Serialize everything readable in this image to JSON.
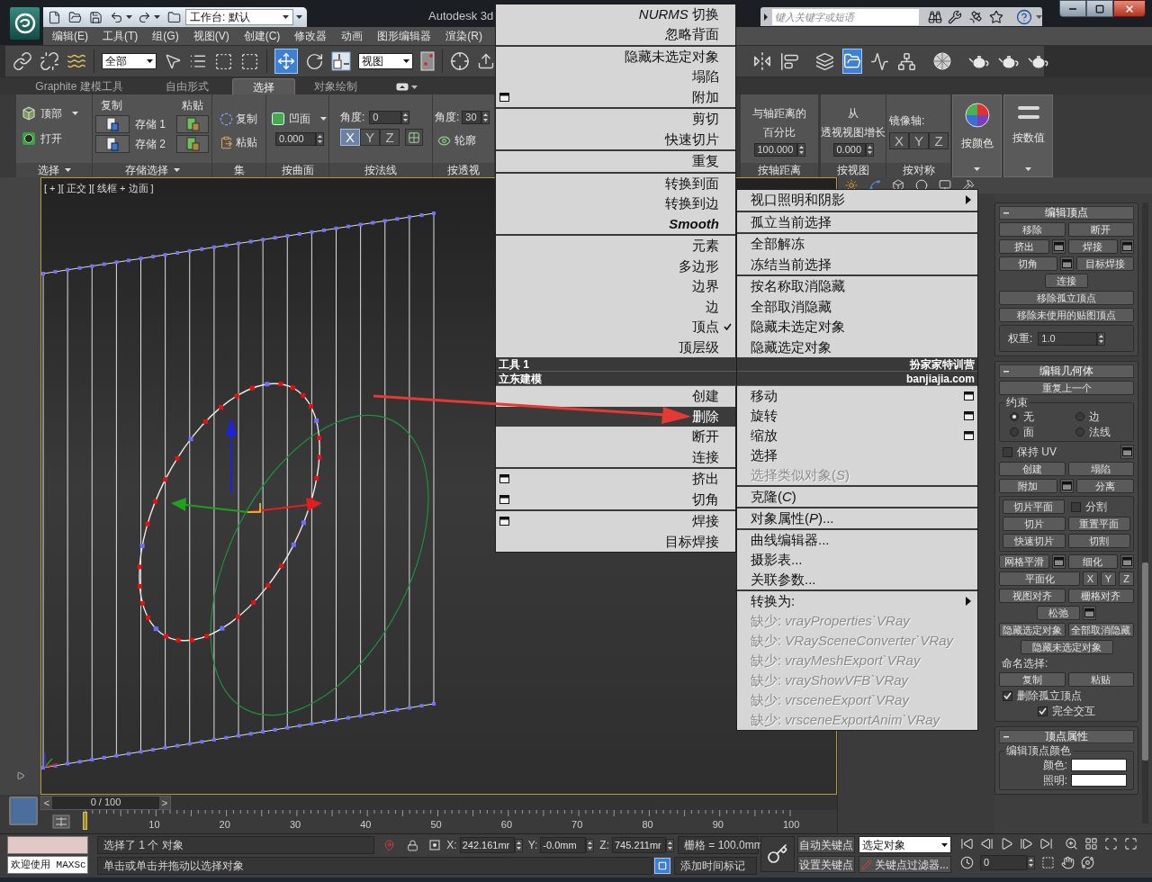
{
  "title_bar": {
    "workspace": "工作台: 默认",
    "app_title": "Autodesk 3d",
    "search": {
      "placeholder": "键入关键字或短语"
    }
  },
  "menu_bar": [
    "编辑(E)",
    "工具(T)",
    "组(G)",
    "视图(V)",
    "创建(C)",
    "修改器",
    "动画",
    "图形编辑器",
    "渲染(R)"
  ],
  "main_toolbar": {
    "selection_filter": "全部",
    "move_tool": {
      "selected": true
    },
    "reference_coord": "视图",
    "explorer_tool": {
      "selected": true
    }
  },
  "ribbon": {
    "tabs": [
      {
        "label": "Graphite 建模工具",
        "selected": false
      },
      {
        "label": "自由形式",
        "selected": false
      },
      {
        "label": "选择",
        "selected": true
      },
      {
        "label": "对象绘制",
        "selected": false
      }
    ],
    "panels_left": [
      {
        "kind": "selection",
        "title": "选择",
        "dropdown": "顶部",
        "button": "打开"
      },
      {
        "kind": "stored",
        "title": "存储选择",
        "copy": "复制",
        "paste": "粘贴",
        "slots": [
          "存储 1",
          "存储 2"
        ]
      },
      {
        "kind": "sets",
        "title": "集",
        "buttons": [
          "复制",
          "粘贴"
        ]
      },
      {
        "kind": "surface",
        "title": "按曲面",
        "dropdown": "凹面",
        "value": "0.000"
      },
      {
        "kind": "normal",
        "title": "按法线",
        "label": "角度:",
        "value": "0",
        "axes": [
          {
            "label": "X",
            "selected": true
          },
          {
            "label": "Y",
            "selected": false
          },
          {
            "label": "Z",
            "selected": false
          }
        ]
      },
      {
        "kind": "perspective",
        "title": "按透视",
        "label": "角度:",
        "value": "30",
        "button": "轮廓"
      }
    ],
    "panels_right": [
      {
        "kind": "distance",
        "title": "按轴距离",
        "caption": [
          "与轴距离的",
          "百分比"
        ],
        "value": "100.000"
      },
      {
        "kind": "view",
        "title": "按视图",
        "caption": [
          "从",
          "透视视图增长"
        ],
        "value": "0.000"
      },
      {
        "kind": "symmetry",
        "title": "按对称",
        "label": "镜像轴:",
        "axes": [
          {
            "label": "X",
            "selected": false
          },
          {
            "label": "Y",
            "selected": false
          },
          {
            "label": "Z",
            "selected": false
          }
        ]
      },
      {
        "kind": "color",
        "title": "按颜色"
      },
      {
        "kind": "numeric",
        "title": "按数值"
      }
    ]
  },
  "viewport": {
    "label": "[ + ][ 正交 ][ 线框 + 边面 ]"
  },
  "command_panel": {
    "rollouts": [
      {
        "title": "编辑顶点",
        "rows": [
          {
            "kind": "row",
            "controls": [
              {
                "kind": "button",
                "label": "移除"
              },
              {
                "kind": "button",
                "label": "断开"
              }
            ]
          },
          {
            "kind": "row",
            "controls": [
              {
                "kind": "button",
                "label": "挤出"
              },
              {
                "kind": "settings"
              },
              {
                "kind": "button",
                "label": "焊接"
              },
              {
                "kind": "settings"
              }
            ]
          },
          {
            "kind": "row",
            "controls": [
              {
                "kind": "button",
                "label": "切角"
              },
              {
                "kind": "settings"
              },
              {
                "kind": "button",
                "label": "目标焊接"
              }
            ]
          },
          {
            "kind": "narrow_row",
            "controls": [
              {
                "kind": "button",
                "label": "连接"
              }
            ]
          },
          {
            "kind": "row",
            "controls": [
              {
                "kind": "button",
                "label": "移除孤立顶点"
              }
            ]
          },
          {
            "kind": "row",
            "controls": [
              {
                "kind": "button",
                "label": "移除未使用的贴图顶点"
              }
            ]
          },
          {
            "kind": "group",
            "rows": [
              {
                "kind": "row",
                "controls": [
                  {
                    "kind": "spinner",
                    "label": "权重:",
                    "value": "1.0"
                  }
                ]
              }
            ]
          }
        ]
      },
      {
        "title": "编辑几何体",
        "rows": [
          {
            "kind": "row",
            "controls": [
              {
                "kind": "button",
                "label": "重复上一个"
              }
            ]
          },
          {
            "kind": "group",
            "title": "约束",
            "rows": [
              {
                "kind": "row",
                "controls": [
                  {
                    "kind": "radio",
                    "label": "无",
                    "selected": true
                  },
                  {
                    "kind": "radio",
                    "label": "边",
                    "selected": false
                  }
                ]
              },
              {
                "kind": "row",
                "controls": [
                  {
                    "kind": "radio",
                    "label": "面",
                    "selected": false
                  },
                  {
                    "kind": "radio",
                    "label": "法线",
                    "selected": false
                  }
                ]
              }
            ]
          },
          {
            "kind": "row",
            "controls": [
              {
                "kind": "checkbox",
                "label": "保持 UV",
                "checked": false
              },
              {
                "kind": "settings"
              }
            ]
          },
          {
            "kind": "row",
            "controls": [
              {
                "kind": "button",
                "label": "创建"
              },
              {
                "kind": "button",
                "label": "塌陷"
              }
            ]
          },
          {
            "kind": "row",
            "controls": [
              {
                "kind": "button",
                "label": "附加"
              },
              {
                "kind": "settings"
              },
              {
                "kind": "button",
                "label": "分离"
              }
            ]
          },
          {
            "kind": "group",
            "rows": [
              {
                "kind": "row",
                "controls": [
                  {
                    "kind": "button",
                    "label": "切片平面"
                  },
                  {
                    "kind": "checkbox",
                    "label": "分割",
                    "checked": false
                  }
                ]
              },
              {
                "kind": "row",
                "controls": [
                  {
                    "kind": "button",
                    "label": "切片"
                  },
                  {
                    "kind": "button",
                    "label": "重置平面"
                  }
                ]
              },
              {
                "kind": "row",
                "controls": [
                  {
                    "kind": "button",
                    "label": "快速切片"
                  },
                  {
                    "kind": "button",
                    "label": "切割"
                  }
                ]
              }
            ]
          },
          {
            "kind": "row",
            "controls": [
              {
                "kind": "button",
                "label": "网格平滑"
              },
              {
                "kind": "settings"
              },
              {
                "kind": "button",
                "label": "细化"
              },
              {
                "kind": "settings"
              }
            ]
          },
          {
            "kind": "row",
            "controls": [
              {
                "kind": "button",
                "label": "平面化"
              },
              {
                "kind": "small_button",
                "label": "X"
              },
              {
                "kind": "small_button",
                "label": "Y"
              },
              {
                "kind": "small_button",
                "label": "Z"
              }
            ]
          },
          {
            "kind": "row",
            "controls": [
              {
                "kind": "button",
                "label": "视图对齐"
              },
              {
                "kind": "button",
                "label": "栅格对齐"
              }
            ]
          },
          {
            "kind": "narrow_row",
            "controls": [
              {
                "kind": "button",
                "label": "松弛"
              },
              {
                "kind": "settings"
              }
            ]
          },
          {
            "kind": "row",
            "controls": [
              {
                "kind": "button",
                "label": "隐藏选定对象"
              },
              {
                "kind": "button",
                "label": "全部取消隐藏"
              }
            ]
          },
          {
            "kind": "narrow_row",
            "controls": [
              {
                "kind": "button",
                "label": "隐藏未选定对象"
              }
            ]
          },
          {
            "kind": "row",
            "controls": [
              {
                "kind": "label",
                "label": "命名选择:"
              }
            ]
          },
          {
            "kind": "row",
            "controls": [
              {
                "kind": "button",
                "label": "复制"
              },
              {
                "kind": "button",
                "label": "粘贴"
              }
            ]
          },
          {
            "kind": "row",
            "controls": [
              {
                "kind": "checkbox",
                "label": "删除孤立顶点",
                "checked": true
              }
            ]
          },
          {
            "kind": "narrow_row",
            "controls": [
              {
                "kind": "checkbox",
                "label": "完全交互",
                "checked": true
              }
            ]
          }
        ]
      },
      {
        "title": "顶点属性",
        "rows": [
          {
            "kind": "group",
            "title": "编辑顶点颜色",
            "rows": [
              {
                "kind": "row",
                "controls": [
                  {
                    "kind": "color_field",
                    "label": "颜色:"
                  }
                ]
              },
              {
                "kind": "row",
                "controls": [
                  {
                    "kind": "color_field",
                    "label": "照明:"
                  }
                ]
              }
            ]
          }
        ]
      }
    ]
  },
  "time_slider": {
    "prev": "<",
    "label": "0 / 100",
    "next": ">",
    "level": 0
  },
  "track_bar": {
    "ticks": [
      "10",
      "20",
      "30",
      "40",
      "50",
      "60",
      "70",
      "80",
      "90",
      "100"
    ]
  },
  "status_bar": {
    "listener_output": "欢迎使用 MAXSc",
    "selection_info": "选择了 1 个 对象",
    "coordinates": [
      {
        "axis": "X:",
        "value": "242.161mr"
      },
      {
        "axis": "Y:",
        "value": "-0.0mm"
      },
      {
        "axis": "Z:",
        "value": "745.211mr"
      }
    ],
    "grid": "栅格 = 100.0mm",
    "prompt": "单击或单击并拖动以选择对象",
    "time_tag": "添加时间标记",
    "auto_key": "自动关键点",
    "key_set": "选定对象",
    "set_key": "设置关键点",
    "key_filters": "关键点过滤器...",
    "frame": "0"
  },
  "quad_menu": {
    "left": {
      "upper": [
        [
          {
            "label": "*NURMS* 切换"
          },
          {
            "label": "忽略背面"
          }
        ],
        [
          {
            "label": "隐藏未选定对象",
            "options": false
          },
          {
            "label": "塌陷",
            "options": false
          },
          {
            "label": "附加",
            "options": true
          }
        ],
        [
          {
            "label": "剪切"
          },
          {
            "label": "快速切片"
          }
        ],
        [
          {
            "label": "重复"
          }
        ],
        [
          {
            "label": "转换到面",
            "italic": false
          },
          {
            "label": "转换到边",
            "italic": false
          },
          {
            "label": "Smooth",
            "italic": true
          }
        ],
        [
          {
            "label": "元素",
            "checked": false
          },
          {
            "label": "多边形",
            "checked": false
          },
          {
            "label": "边界",
            "checked": false
          },
          {
            "label": "边",
            "checked": false
          },
          {
            "label": "顶点",
            "checked": true
          },
          {
            "label": "顶层级",
            "checked": false
          }
        ]
      ],
      "headers": [
        "工具 1",
        "立东建模"
      ],
      "lower": [
        [
          {
            "label": "创建",
            "highlighted": false
          },
          {
            "label": "删除",
            "highlighted": true
          },
          {
            "label": "断开",
            "highlighted": false
          },
          {
            "label": "连接",
            "highlighted": false
          }
        ],
        [
          {
            "label": "挤出",
            "options": true
          },
          {
            "label": "切角",
            "options": true
          }
        ],
        [
          {
            "label": "焊接",
            "options": true
          },
          {
            "label": "目标焊接",
            "options": false
          }
        ]
      ]
    },
    "right": {
      "upper": [
        [
          {
            "label": "视口照明和阴影",
            "submenu": true
          }
        ],
        [
          {
            "label": "孤立当前选择"
          }
        ],
        [
          {
            "label": "全部解冻"
          },
          {
            "label": "冻结当前选择"
          }
        ],
        [
          {
            "label": "按名称取消隐藏"
          },
          {
            "label": "全部取消隐藏"
          },
          {
            "label": "隐藏未选定对象"
          },
          {
            "label": "隐藏选定对象"
          }
        ]
      ],
      "headers": [
        "扮家家特训营",
        "banjiajia.com"
      ],
      "lower": [
        [
          {
            "label": "移动",
            "options": true,
            "disabled": false
          },
          {
            "label": "旋转",
            "options": true,
            "disabled": false
          },
          {
            "label": "缩放",
            "options": true,
            "disabled": false
          },
          {
            "label": "选择",
            "options": false,
            "disabled": false
          },
          {
            "label": "选择类似对象(*S*)",
            "options": false,
            "disabled": true
          }
        ],
        [
          {
            "label": "克隆(*C*)"
          }
        ],
        [
          {
            "label": "对象属性(*P*)..."
          }
        ],
        [
          {
            "label": "曲线编辑器..."
          },
          {
            "label": "摄影表..."
          },
          {
            "label": "关联参数..."
          }
        ],
        [
          {
            "label": "转换为:",
            "submenu": true,
            "disabled": false
          },
          {
            "label": "缺少: *vrayProperties`VRay*",
            "submenu": false,
            "disabled": true
          },
          {
            "label": "缺少: *VRaySceneConverter`VRay*",
            "submenu": false,
            "disabled": true
          },
          {
            "label": "缺少: *vrayMeshExport`VRay*",
            "submenu": false,
            "disabled": true
          },
          {
            "label": "缺少: *vrayShowVFB`VRay*",
            "submenu": false,
            "disabled": true
          },
          {
            "label": "缺少: *vrsceneExport`VRay*",
            "submenu": false,
            "disabled": true
          },
          {
            "label": "缺少: *vrsceneExportAnim`VRay*",
            "submenu": false,
            "disabled": true
          }
        ]
      ]
    }
  }
}
